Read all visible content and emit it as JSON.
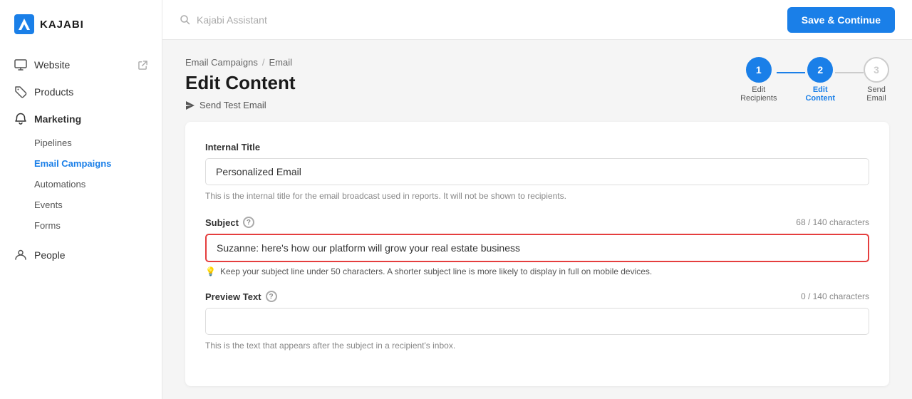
{
  "logo": {
    "text": "KAJABI"
  },
  "sidebar": {
    "items": [
      {
        "id": "website",
        "label": "Website",
        "icon": "monitor",
        "hasExternal": true
      },
      {
        "id": "products",
        "label": "Products",
        "icon": "tag"
      },
      {
        "id": "marketing",
        "label": "Marketing",
        "icon": "bell",
        "isExpanded": true
      },
      {
        "id": "people",
        "label": "People",
        "icon": "person"
      }
    ],
    "sub_items": [
      {
        "id": "pipelines",
        "label": "Pipelines",
        "active": false
      },
      {
        "id": "email-campaigns",
        "label": "Email Campaigns",
        "active": true
      },
      {
        "id": "automations",
        "label": "Automations",
        "active": false
      },
      {
        "id": "events",
        "label": "Events",
        "active": false
      },
      {
        "id": "forms",
        "label": "Forms",
        "active": false
      }
    ]
  },
  "topbar": {
    "search_placeholder": "Kajabi Assistant",
    "save_button_label": "Save & Continue"
  },
  "breadcrumb": {
    "parent": "Email Campaigns",
    "separator": "/",
    "current": "Email"
  },
  "page": {
    "title": "Edit Content",
    "send_test_label": "Send Test Email"
  },
  "steps": [
    {
      "number": "1",
      "label": "Edit\nRecipients",
      "state": "completed"
    },
    {
      "number": "2",
      "label": "Edit\nContent",
      "state": "active"
    },
    {
      "number": "3",
      "label": "Send\nEmail",
      "state": "inactive"
    }
  ],
  "form": {
    "internal_title_label": "Internal Title",
    "internal_title_value": "Personalized Email",
    "internal_title_hint": "This is the internal title for the email broadcast used in reports. It will not be shown to recipients.",
    "subject_label": "Subject",
    "subject_char_count": "68 / 140 characters",
    "subject_value": "Suzanne: here's how our platform will grow your real estate business",
    "subject_hint": "Keep your subject line under 50 characters. A shorter subject line is more likely to display in full on mobile devices.",
    "preview_text_label": "Preview Text",
    "preview_text_char_count": "0 / 140 characters",
    "preview_text_value": "",
    "preview_text_placeholder": "",
    "preview_text_hint": "This is the text that appears after the subject in a recipient's inbox."
  }
}
